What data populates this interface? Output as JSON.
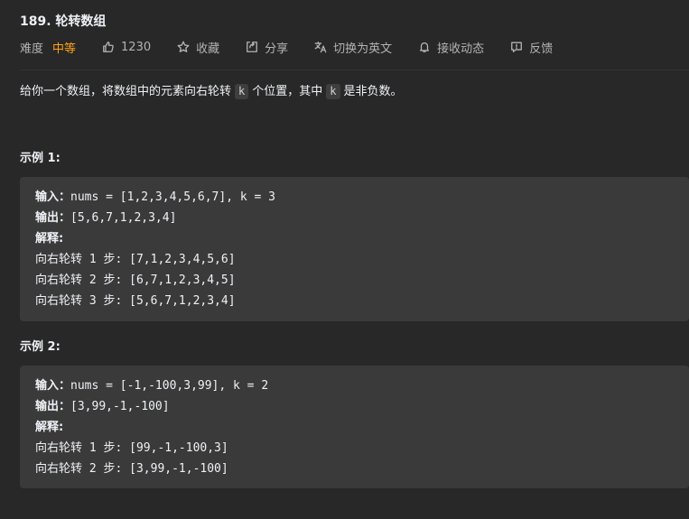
{
  "problem": {
    "title": "189. 轮转数组"
  },
  "meta": {
    "difficulty_label": "难度",
    "difficulty_value": "中等",
    "likes": "1230",
    "favorite_label": "收藏",
    "share_label": "分享",
    "switch_lang_label": "切换为英文",
    "notify_label": "接收动态",
    "feedback_label": "反馈",
    "difficulty_color": "#ffa116"
  },
  "description": {
    "part1": "给你一个数组，将数组中的元素向右轮转",
    "code1": "k",
    "part2": "个位置，其中",
    "code2": "k",
    "part3": "是非负数。"
  },
  "examples": [
    {
      "title": "示例 1:",
      "input_label": "输入：",
      "input_value": "nums = [1,2,3,4,5,6,7], k = 3",
      "output_label": "输出：",
      "output_value": "[5,6,7,1,2,3,4]",
      "explain_label": "解释:",
      "steps": [
        "向右轮转 1 步: [7,1,2,3,4,5,6]",
        "向右轮转 2 步: [6,7,1,2,3,4,5]",
        "向右轮转 3 步: [5,6,7,1,2,3,4]"
      ]
    },
    {
      "title": "示例 2:",
      "input_label": "输入：",
      "input_value": "nums = [-1,-100,3,99], k = 2",
      "output_label": "输出：",
      "output_value": "[3,99,-1,-100]",
      "explain_label": "解释:",
      "steps": [
        "向右轮转 1 步: [99,-1,-100,3]",
        "向右轮转 2 步: [3,99,-1,-100]"
      ]
    }
  ]
}
